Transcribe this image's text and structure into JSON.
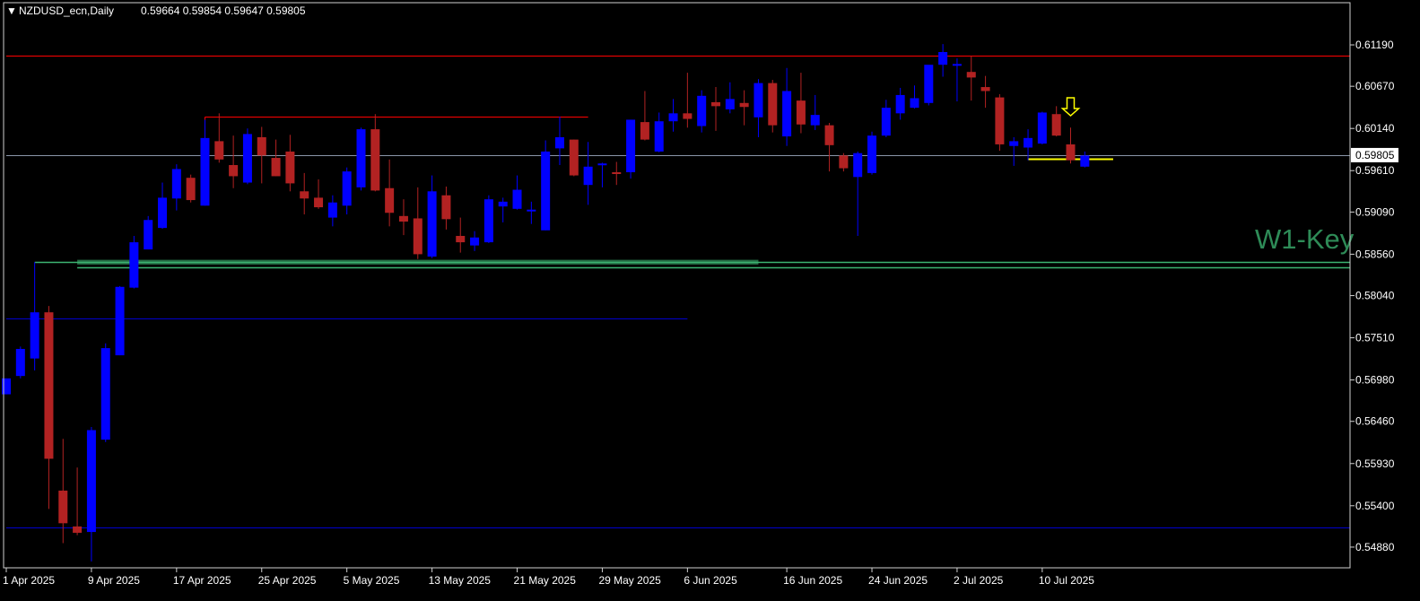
{
  "header": {
    "symbol": "NZDUSD_ecn,Daily",
    "ohlc": "0.59664 0.59854 0.59647 0.59805"
  },
  "chart_data": {
    "type": "candlestick",
    "symbol": "NZDUSD_ecn",
    "timeframe": "Daily",
    "ylim": [
      0.5462,
      0.6172
    ],
    "y_ticks": [
      "0.61190",
      "0.60670",
      "0.60140",
      "0.59610",
      "0.59090",
      "0.58560",
      "0.58040",
      "0.57510",
      "0.56980",
      "0.56460",
      "0.55930",
      "0.55400",
      "0.54880"
    ],
    "x_ticks": [
      "1 Apr 2025",
      "9 Apr 2025",
      "17 Apr 2025",
      "25 Apr 2025",
      "5 May 2025",
      "13 May 2025",
      "21 May 2025",
      "29 May 2025",
      "6 Jun 2025",
      "16 Jun 2025",
      "24 Jun 2025",
      "2 Jul 2025",
      "10 Jul 2025"
    ],
    "current_price_label": "0.59805",
    "annotation_text": "W1-Key",
    "colors": {
      "bull": "#0000ff",
      "bear": "#b22222",
      "price_line": "#8a96a8",
      "resistance": "#ff0000",
      "support_zone": "#3cb371",
      "blue_line": "#0000cd",
      "marker": "#ffff00",
      "axis_text": "#ffffff",
      "annotation": "#2e8b57"
    },
    "candles": [
      {
        "o": 0.568,
        "h": 0.57,
        "l": 0.568,
        "c": 0.57
      },
      {
        "o": 0.5703,
        "h": 0.574,
        "l": 0.57,
        "c": 0.5737
      },
      {
        "o": 0.5725,
        "h": 0.5846,
        "l": 0.571,
        "c": 0.5783
      },
      {
        "o": 0.5783,
        "h": 0.5791,
        "l": 0.5536,
        "c": 0.5599
      },
      {
        "o": 0.5559,
        "h": 0.5624,
        "l": 0.5493,
        "c": 0.5518
      },
      {
        "o": 0.5514,
        "h": 0.5588,
        "l": 0.5503,
        "c": 0.5506
      },
      {
        "o": 0.5507,
        "h": 0.5639,
        "l": 0.547,
        "c": 0.5635
      },
      {
        "o": 0.5623,
        "h": 0.5744,
        "l": 0.562,
        "c": 0.5738
      },
      {
        "o": 0.5729,
        "h": 0.5816,
        "l": 0.5729,
        "c": 0.5815
      },
      {
        "o": 0.5814,
        "h": 0.5879,
        "l": 0.5813,
        "c": 0.5871
      },
      {
        "o": 0.5862,
        "h": 0.5904,
        "l": 0.5862,
        "c": 0.5899
      },
      {
        "o": 0.5889,
        "h": 0.5946,
        "l": 0.5888,
        "c": 0.5927
      },
      {
        "o": 0.5926,
        "h": 0.5969,
        "l": 0.5911,
        "c": 0.5963
      },
      {
        "o": 0.5952,
        "h": 0.5956,
        "l": 0.5921,
        "c": 0.5924
      },
      {
        "o": 0.5917,
        "h": 0.6025,
        "l": 0.5917,
        "c": 0.6002
      },
      {
        "o": 0.5998,
        "h": 0.6033,
        "l": 0.5971,
        "c": 0.5975
      },
      {
        "o": 0.5968,
        "h": 0.6005,
        "l": 0.5939,
        "c": 0.5954
      },
      {
        "o": 0.5946,
        "h": 0.6014,
        "l": 0.5944,
        "c": 0.6007
      },
      {
        "o": 0.6003,
        "h": 0.6016,
        "l": 0.5945,
        "c": 0.598
      },
      {
        "o": 0.5977,
        "h": 0.6,
        "l": 0.5954,
        "c": 0.5954
      },
      {
        "o": 0.5985,
        "h": 0.6006,
        "l": 0.5935,
        "c": 0.5945
      },
      {
        "o": 0.5935,
        "h": 0.5958,
        "l": 0.5906,
        "c": 0.5926
      },
      {
        "o": 0.5927,
        "h": 0.595,
        "l": 0.5913,
        "c": 0.5915
      },
      {
        "o": 0.5902,
        "h": 0.593,
        "l": 0.5891,
        "c": 0.5921
      },
      {
        "o": 0.5917,
        "h": 0.5965,
        "l": 0.5906,
        "c": 0.596
      },
      {
        "o": 0.594,
        "h": 0.6015,
        "l": 0.5936,
        "c": 0.6013
      },
      {
        "o": 0.6013,
        "h": 0.6032,
        "l": 0.5935,
        "c": 0.5936
      },
      {
        "o": 0.5939,
        "h": 0.5975,
        "l": 0.5891,
        "c": 0.5908
      },
      {
        "o": 0.5904,
        "h": 0.5925,
        "l": 0.588,
        "c": 0.5897
      },
      {
        "o": 0.5901,
        "h": 0.594,
        "l": 0.585,
        "c": 0.5856
      },
      {
        "o": 0.5853,
        "h": 0.5955,
        "l": 0.5851,
        "c": 0.5935
      },
      {
        "o": 0.593,
        "h": 0.5941,
        "l": 0.5887,
        "c": 0.59
      },
      {
        "o": 0.5879,
        "h": 0.5902,
        "l": 0.5858,
        "c": 0.5871
      },
      {
        "o": 0.5867,
        "h": 0.5885,
        "l": 0.586,
        "c": 0.5877
      },
      {
        "o": 0.5871,
        "h": 0.593,
        "l": 0.587,
        "c": 0.5925
      },
      {
        "o": 0.5916,
        "h": 0.5927,
        "l": 0.5896,
        "c": 0.5922
      },
      {
        "o": 0.5913,
        "h": 0.5955,
        "l": 0.5912,
        "c": 0.5937
      },
      {
        "o": 0.591,
        "h": 0.5922,
        "l": 0.5894,
        "c": 0.5912
      },
      {
        "o": 0.5886,
        "h": 0.5999,
        "l": 0.5886,
        "c": 0.5985
      },
      {
        "o": 0.5989,
        "h": 0.6029,
        "l": 0.5968,
        "c": 0.6003
      },
      {
        "o": 0.6,
        "h": 0.6,
        "l": 0.5954,
        "c": 0.5955
      },
      {
        "o": 0.5943,
        "h": 0.5997,
        "l": 0.5918,
        "c": 0.5966
      },
      {
        "o": 0.5968,
        "h": 0.5971,
        "l": 0.594,
        "c": 0.597
      },
      {
        "o": 0.5959,
        "h": 0.5972,
        "l": 0.5943,
        "c": 0.5958
      },
      {
        "o": 0.5959,
        "h": 0.6025,
        "l": 0.5951,
        "c": 0.6025
      },
      {
        "o": 0.6022,
        "h": 0.6061,
        "l": 0.5999,
        "c": 0.6
      },
      {
        "o": 0.5985,
        "h": 0.6034,
        "l": 0.5984,
        "c": 0.6023
      },
      {
        "o": 0.6023,
        "h": 0.6051,
        "l": 0.601,
        "c": 0.6033
      },
      {
        "o": 0.6033,
        "h": 0.6084,
        "l": 0.6015,
        "c": 0.6026
      },
      {
        "o": 0.6017,
        "h": 0.6062,
        "l": 0.6009,
        "c": 0.6055
      },
      {
        "o": 0.6047,
        "h": 0.6066,
        "l": 0.6011,
        "c": 0.6042
      },
      {
        "o": 0.6038,
        "h": 0.6072,
        "l": 0.6033,
        "c": 0.6051
      },
      {
        "o": 0.6046,
        "h": 0.6062,
        "l": 0.6018,
        "c": 0.6041
      },
      {
        "o": 0.6028,
        "h": 0.6076,
        "l": 0.6003,
        "c": 0.6071
      },
      {
        "o": 0.6071,
        "h": 0.6075,
        "l": 0.6009,
        "c": 0.6018
      },
      {
        "o": 0.6004,
        "h": 0.609,
        "l": 0.5992,
        "c": 0.6061
      },
      {
        "o": 0.6049,
        "h": 0.6084,
        "l": 0.6008,
        "c": 0.6019
      },
      {
        "o": 0.6018,
        "h": 0.6056,
        "l": 0.6012,
        "c": 0.6031
      },
      {
        "o": 0.6018,
        "h": 0.6021,
        "l": 0.596,
        "c": 0.5993
      },
      {
        "o": 0.598,
        "h": 0.5983,
        "l": 0.596,
        "c": 0.5964
      },
      {
        "o": 0.5953,
        "h": 0.5985,
        "l": 0.5879,
        "c": 0.5983
      },
      {
        "o": 0.5958,
        "h": 0.601,
        "l": 0.5956,
        "c": 0.6005
      },
      {
        "o": 0.6005,
        "h": 0.605,
        "l": 0.6003,
        "c": 0.604
      },
      {
        "o": 0.6033,
        "h": 0.6065,
        "l": 0.6025,
        "c": 0.6056
      },
      {
        "o": 0.604,
        "h": 0.6068,
        "l": 0.6039,
        "c": 0.6052
      },
      {
        "o": 0.6046,
        "h": 0.609,
        "l": 0.6043,
        "c": 0.6094
      },
      {
        "o": 0.6094,
        "h": 0.612,
        "l": 0.6079,
        "c": 0.611
      },
      {
        "o": 0.6094,
        "h": 0.6102,
        "l": 0.6048,
        "c": 0.6095
      },
      {
        "o": 0.6085,
        "h": 0.6105,
        "l": 0.6049,
        "c": 0.6078
      },
      {
        "o": 0.6066,
        "h": 0.608,
        "l": 0.604,
        "c": 0.6061
      },
      {
        "o": 0.6053,
        "h": 0.6057,
        "l": 0.5986,
        "c": 0.5994
      },
      {
        "o": 0.5992,
        "h": 0.6003,
        "l": 0.5967,
        "c": 0.5998
      },
      {
        "o": 0.599,
        "h": 0.6013,
        "l": 0.5974,
        "c": 0.6002
      },
      {
        "o": 0.5995,
        "h": 0.6035,
        "l": 0.5994,
        "c": 0.6034
      },
      {
        "o": 0.6032,
        "h": 0.6042,
        "l": 0.6004,
        "c": 0.6005
      },
      {
        "o": 0.5994,
        "h": 0.6015,
        "l": 0.597,
        "c": 0.5974
      },
      {
        "o": 0.5966,
        "h": 0.5985,
        "l": 0.5965,
        "c": 0.598
      }
    ],
    "lines": [
      {
        "kind": "resistance",
        "price": 0.6106,
        "from_index": 0,
        "to_end": true
      },
      {
        "kind": "resistance-short",
        "price": 0.6029,
        "from_index": 14,
        "to_index": 41
      },
      {
        "kind": "price",
        "price": 0.59805,
        "from_index": 0,
        "to_end": true
      },
      {
        "kind": "support-green",
        "price": 0.5846,
        "from_index": 2,
        "to_end": true
      },
      {
        "kind": "support-green",
        "price": 0.584,
        "from_index": 5,
        "to_end": true
      },
      {
        "kind": "blue",
        "price": 0.5775,
        "from_index": 0,
        "to_index": 48
      },
      {
        "kind": "blue",
        "price": 0.5513,
        "from_index": 0,
        "to_end": true
      },
      {
        "kind": "marker-yellow",
        "price": 0.5976,
        "from_index": 72,
        "to_index": 78
      }
    ],
    "zone": {
      "from_price": 0.5843,
      "to_price": 0.5849,
      "from_index": 5,
      "to_index": 53
    },
    "arrow": {
      "index": 75,
      "price": 0.603,
      "direction": "down"
    }
  }
}
